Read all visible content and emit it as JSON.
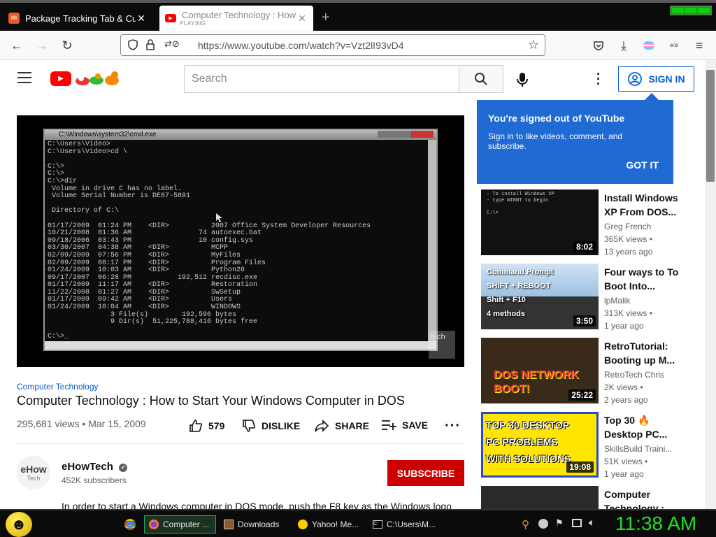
{
  "browser": {
    "tabs": [
      {
        "title": "Package Tracking Tab & Custom",
        "favicon": "package-icon"
      },
      {
        "title": "Computer Technology : How to Start",
        "status": "PLAYING",
        "favicon": "youtube-icon"
      }
    ],
    "url": "https://www.youtube.com/watch?v=Vzt2lI93vD4"
  },
  "youtube": {
    "search_placeholder": "Search",
    "signin_label": "SIGN IN"
  },
  "video": {
    "tag": "Computer Technology",
    "title": "Computer Technology : How to Start Your Windows Computer in DOS",
    "views": "295,681 views",
    "date": "Mar 15, 2009",
    "likes": "579",
    "dislike": "DISLIKE",
    "share": "SHARE",
    "save": "SAVE",
    "watermark": "tech",
    "cmd_title": "C:\\Windows\\system32\\cmd.exe",
    "cmd_text": "C:\\Users\\Video>\nC:\\Users\\Video>cd \\\n\nC:\\>\nC:\\>\nC:\\>dir\n Volume in drive C has no label.\n Volume Serial Number is DE87-5891\n\n Directory of C:\\\n\n01/17/2009  01:24 PM    <DIR>          2007 Office System Developer Resources\n10/21/2008  01:36 AM                74 autoexec.bat\n09/18/2006  03:43 PM                10 config.sys\n03/30/2007  04:38 AM    <DIR>          MCPP\n02/09/2009  07:56 PM    <DIR>          MyFiles\n02/09/2009  08:17 PM    <DIR>          Program Files\n01/24/2009  10:03 AM    <DIR>          Python26\n09/17/2007  06:28 PM           192,512 recdisc.exe\n01/17/2009  11:17 AM    <DIR>          Restoration\n11/22/2008  01:27 AM    <DIR>          SwSetup\n01/17/2009  09:42 AM    <DIR>          Users\n01/24/2009  10:04 AM    <DIR>          WINDOWS\n               3 File(s)        192,596 bytes\n               9 Dir(s)  51,225,788,416 bytes free\n\nC:\\>_"
  },
  "channel": {
    "avatar_text": "eHow",
    "avatar_sub": "Tech",
    "name": "eHowTech",
    "subscribers": "452K subscribers",
    "subscribe_label": "SUBSCRIBE"
  },
  "description": "In order to start a Windows computer in DOS mode, push the F8 key as the Windows logo",
  "popup": {
    "title": "You're signed out of YouTube",
    "body": "Sign in to like videos, comment, and subscribe.",
    "button": "GOT IT"
  },
  "recommendations": [
    {
      "title": "Install Windows XP From DOS...",
      "channel": "Greg French",
      "views": "365K views •",
      "age": "13 years ago",
      "duration": "8:02",
      "thumb_text": "- To install Windows XP\n- type WINNT to begin\n\nC:\\>"
    },
    {
      "title": "Four ways to To Boot Into...",
      "channel": "ipMalik",
      "views": "313K views •",
      "age": "1 year ago",
      "duration": "3:50",
      "thumb_text": "Command Prompt\nSHIFT + REBOOT\nShift + F10\n4 methods"
    },
    {
      "title": "RetroTutorial: Booting up M...",
      "channel": "RetroTech Chris",
      "views": "2K views •",
      "age": "2 years ago",
      "duration": "25:22",
      "thumb_text": "DOS NETWORK\nBOOT!"
    },
    {
      "title": "Top 30 🔥 Desktop PC...",
      "channel": "SkillsBuild Traini...",
      "views": "51K views •",
      "age": "1 year ago",
      "duration": "19:08",
      "thumb_text": "TOP 30 DESKTOP\nPC PROBLEMS\nWITH SOLUTIONS"
    },
    {
      "title": "Computer Technology :",
      "channel": "",
      "views": "",
      "age": "",
      "duration": "",
      "thumb_text": ""
    }
  ],
  "taskbar": {
    "items": [
      "Computer ...",
      "Downloads",
      "Yahoo! Me...",
      "C:\\Users\\M..."
    ],
    "clock": "11:38 AM"
  },
  "colors": {
    "youtube_red": "#ff0000",
    "link_blue": "#065fd4",
    "popup_blue": "#1f6ad3",
    "clock_green": "#1ee01e"
  }
}
